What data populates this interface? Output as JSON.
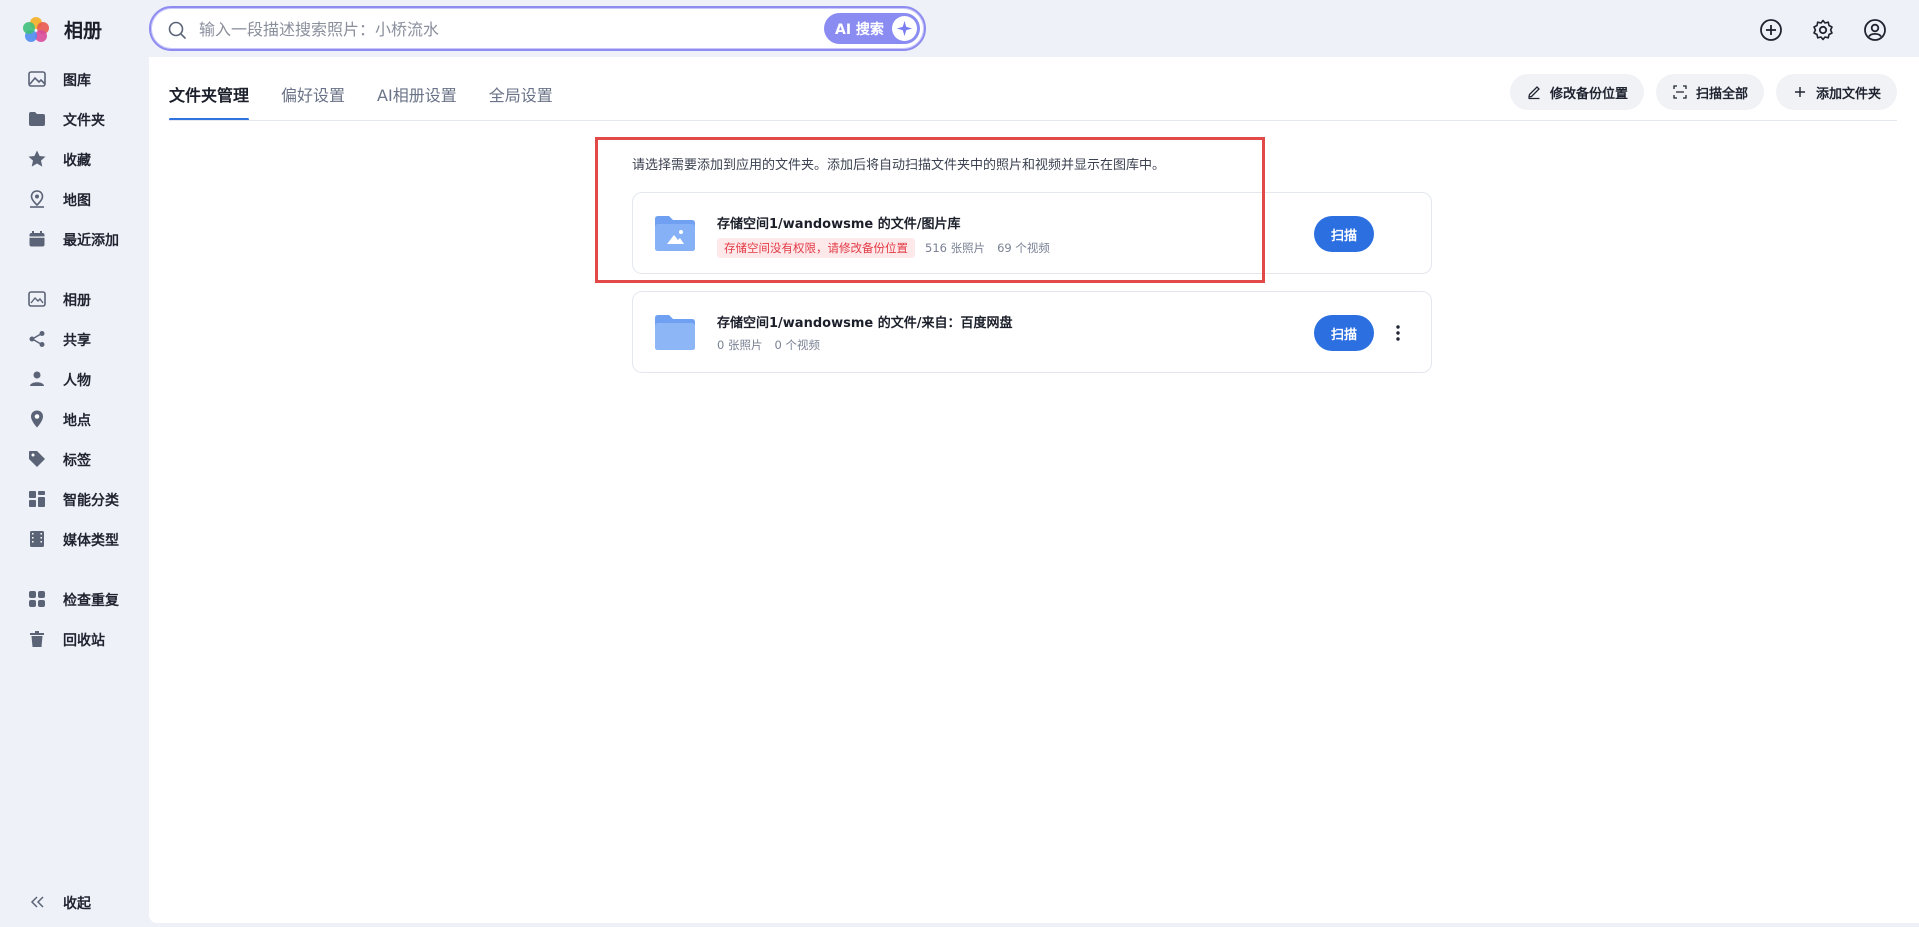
{
  "app": {
    "title": "相册"
  },
  "search": {
    "placeholder": "输入一段描述搜索照片：小桥流水",
    "ai_label": "AI 搜索"
  },
  "top_icons": [
    "add-circle-icon",
    "gear-icon",
    "user-circle-icon"
  ],
  "sidebar": {
    "items": [
      {
        "label": "图库",
        "icon": "image-icon"
      },
      {
        "label": "文件夹",
        "icon": "folder-icon"
      },
      {
        "label": "收藏",
        "icon": "star-icon"
      },
      {
        "label": "地图",
        "icon": "map-pin-icon"
      },
      {
        "label": "最近添加",
        "icon": "calendar-icon"
      },
      {
        "label": "相册",
        "icon": "album-icon"
      },
      {
        "label": "共享",
        "icon": "share-icon"
      },
      {
        "label": "人物",
        "icon": "person-icon"
      },
      {
        "label": "地点",
        "icon": "location-icon"
      },
      {
        "label": "标签",
        "icon": "tag-icon"
      },
      {
        "label": "智能分类",
        "icon": "grid-icon"
      },
      {
        "label": "媒体类型",
        "icon": "film-icon"
      },
      {
        "label": "检查重复",
        "icon": "duplicate-icon"
      },
      {
        "label": "回收站",
        "icon": "trash-icon"
      }
    ],
    "collapse_label": "收起"
  },
  "tabs": [
    {
      "label": "文件夹管理",
      "active": true
    },
    {
      "label": "偏好设置",
      "active": false
    },
    {
      "label": "AI相册设置",
      "active": false
    },
    {
      "label": "全局设置",
      "active": false
    }
  ],
  "actions": {
    "edit_backup": "修改备份位置",
    "scan_all": "扫描全部",
    "add_folder": "添加文件夹"
  },
  "hint": "请选择需要添加到应用的文件夹。添加后将自动扫描文件夹中的照片和视频并显示在图库中。",
  "folders": [
    {
      "title": "存储空间1/wandowsme 的文件/图片库",
      "warning": "存储空间没有权限，请修改备份位置",
      "photos": "516 张照片",
      "videos": "69 个视频",
      "scan_label": "扫描"
    },
    {
      "title": "存储空间1/wandowsme 的文件/来自：百度网盘",
      "photos": "0 张照片",
      "videos": "0 个视频",
      "scan_label": "扫描"
    }
  ],
  "colors": {
    "accent": "#2c6fe0",
    "highlight": "#e24a4a",
    "warning_text": "#e23a45",
    "warning_bg": "#fde9ea"
  }
}
